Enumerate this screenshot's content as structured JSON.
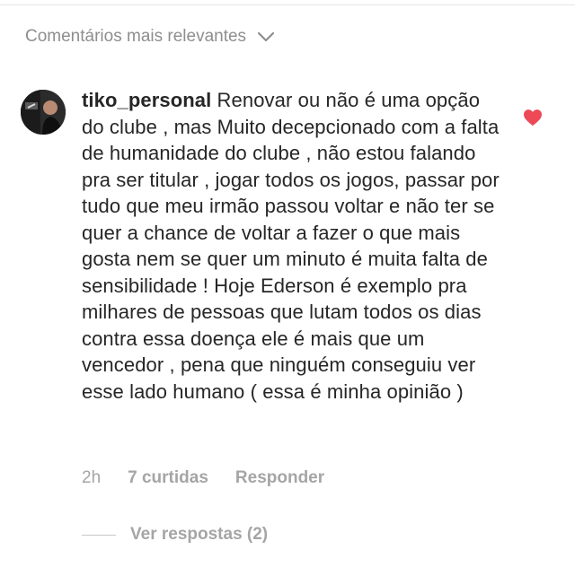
{
  "sort": {
    "label": "Comentários mais relevantes",
    "icon": "chevron-down-icon"
  },
  "comment": {
    "username": "tiko_personal",
    "text": " Renovar ou não é uma opção do clube , mas Muito decepcionado com a falta de humanidade do clube , não estou falando pra ser titular , jogar todos os jogos, passar por tudo que meu irmão passou voltar e não ter se quer a chance de voltar a fazer o que mais gosta nem se quer um minuto é muita falta de sensibilidade ! Hoje Ederson é exemplo pra milhares de pessoas que lutam todos os dias contra essa doença ele é mais que um vencedor , pena que ninguém conseguiu ver esse lado humano ( essa é minha opinião )",
    "liked": true,
    "heart_color": "#ed4956",
    "icon": "heart-icon"
  },
  "meta": {
    "time": "2h",
    "likes": "7 curtidas",
    "reply": "Responder"
  },
  "replies": {
    "label": "Ver respostas (2)"
  },
  "colors": {
    "text": "#262626",
    "secondary": "#8e8e8e"
  }
}
